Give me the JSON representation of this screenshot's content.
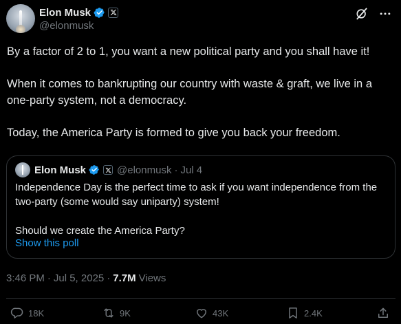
{
  "author": {
    "name": "Elon Musk",
    "handle": "@elonmusk"
  },
  "tweet_text": [
    "By a factor of 2 to 1, you want a new political party and you shall have it!",
    "When it comes to bankrupting our country with waste & graft, we live in a one-party system, not a democracy.",
    "Today, the America Party is formed to give you back your freedom."
  ],
  "quote": {
    "name": "Elon Musk",
    "handle": "@elonmusk",
    "separator": "·",
    "date": "Jul 4",
    "text": [
      "Independence Day is the perfect time to ask if you want independence from the two-party (some would say uniparty) system!",
      "Should we create the America Party?"
    ],
    "show_poll_label": "Show this poll"
  },
  "meta": {
    "time": "3:46 PM",
    "separator1": "·",
    "date": "Jul 5, 2025",
    "separator2": "·",
    "views_count": "7.7M",
    "views_label": "Views"
  },
  "actions": {
    "replies": "18K",
    "reposts": "9K",
    "likes": "43K",
    "bookmarks": "2.4K"
  },
  "colors": {
    "background": "#000000",
    "text": "#e7e9ea",
    "secondary": "#71767b",
    "link": "#1d9bf0",
    "verified": "#1d9bf0",
    "border": "#2f3336"
  },
  "icons": {
    "verified": "verified-badge-icon",
    "affiliate": "x-logo-icon",
    "grok": "grok-icon",
    "more": "more-icon",
    "reply": "reply-icon",
    "repost": "repost-icon",
    "like": "heart-icon",
    "bookmark": "bookmark-icon",
    "share": "share-icon"
  }
}
